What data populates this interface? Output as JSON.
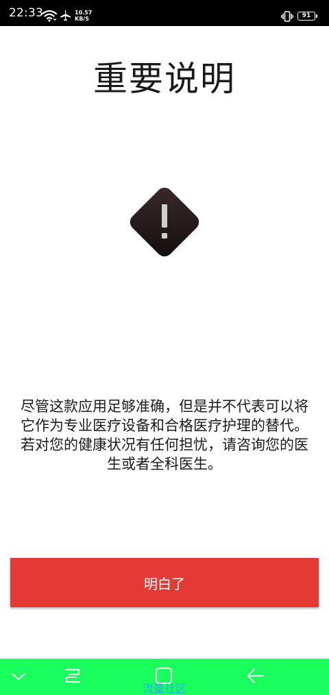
{
  "status_bar": {
    "time": "22:33",
    "net_speed_value": "10.57",
    "net_speed_unit": "KB/S",
    "battery_level": "91",
    "icons": [
      "wifi-icon",
      "airplane-icon",
      "vibrate-icon",
      "battery-icon"
    ]
  },
  "page": {
    "title": "重要说明",
    "warning_icon": "warning-exclamation-icon",
    "notice_lines": [
      "尽管这款应用足够准确，但是并不代表可以将它作为专业医疗设备和合格医疗护理的替代。",
      "若对您的健康状况有任何担忧，请咨询您的医生或者全科医生。"
    ],
    "confirm_label": "明白了"
  },
  "nav_bar": {
    "buttons": [
      "chevron-down-icon",
      "recents-icon",
      "home-icon",
      "back-icon"
    ],
    "watermark": "流量社区"
  },
  "colors": {
    "status_bar_bg": "#000000",
    "button_bg": "#e53935",
    "nav_bar_bg": "#18ff5e",
    "warning_diamond": "#2a1e1e",
    "watermark": "#2aa3ff"
  }
}
